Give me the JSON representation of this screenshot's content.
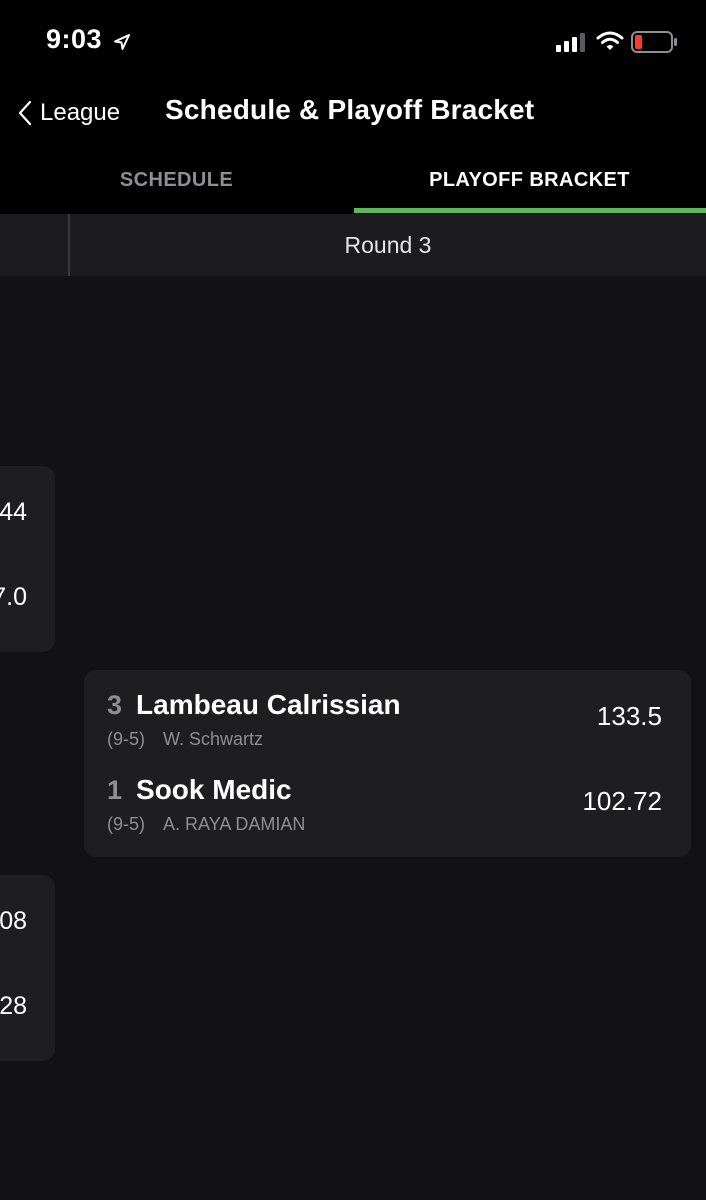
{
  "status_bar": {
    "time": "9:03",
    "icons": [
      "location-arrow-icon",
      "cellular-signal-icon",
      "wifi-icon",
      "battery-low-icon"
    ]
  },
  "nav": {
    "back_label": "League",
    "title": "Schedule & Playoff Bracket"
  },
  "tabs": [
    {
      "label": "SCHEDULE",
      "active": false
    },
    {
      "label": "PLAYOFF BRACKET",
      "active": true
    }
  ],
  "round": {
    "label": "Round 3"
  },
  "left_cards": [
    {
      "score_top": "44",
      "score_bottom": "7.0"
    },
    {
      "score_top": "08",
      "score_bottom": "28"
    }
  ],
  "matchup": {
    "teams": [
      {
        "seed": "3",
        "name": "Lambeau Calrissian",
        "record": "(9-5)",
        "owner": "W. Schwartz",
        "score": "133.5"
      },
      {
        "seed": "1",
        "name": "Sook Medic",
        "record": "(9-5)",
        "owner": "A. RAYA DAMIAN",
        "score": "102.72"
      }
    ]
  },
  "colors": {
    "accent": "#5cb85c",
    "battery_low": "#ff3b30",
    "background": "#121214",
    "card": "#1e1e20"
  }
}
